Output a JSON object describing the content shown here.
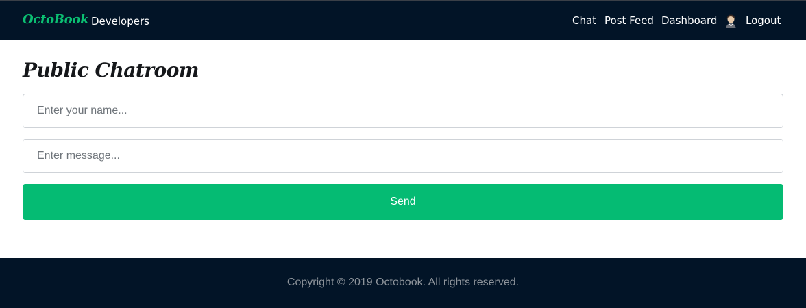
{
  "navbar": {
    "brand": "OctoBook",
    "developers_label": "Developers",
    "links": {
      "chat": "Chat",
      "post_feed": "Post Feed",
      "dashboard": "Dashboard",
      "logout": "Logout"
    },
    "avatar_icon": "user-avatar-icon",
    "brand_color": "#0bbf72",
    "background_color": "#021427"
  },
  "main": {
    "title": "Public Chatroom",
    "name_input": {
      "placeholder": "Enter your name...",
      "value": ""
    },
    "message_input": {
      "placeholder": "Enter message...",
      "value": ""
    },
    "send_label": "Send",
    "send_color": "#05bb73"
  },
  "footer": {
    "copyright": "Copyright © 2019 Octobook. All rights reserved."
  }
}
